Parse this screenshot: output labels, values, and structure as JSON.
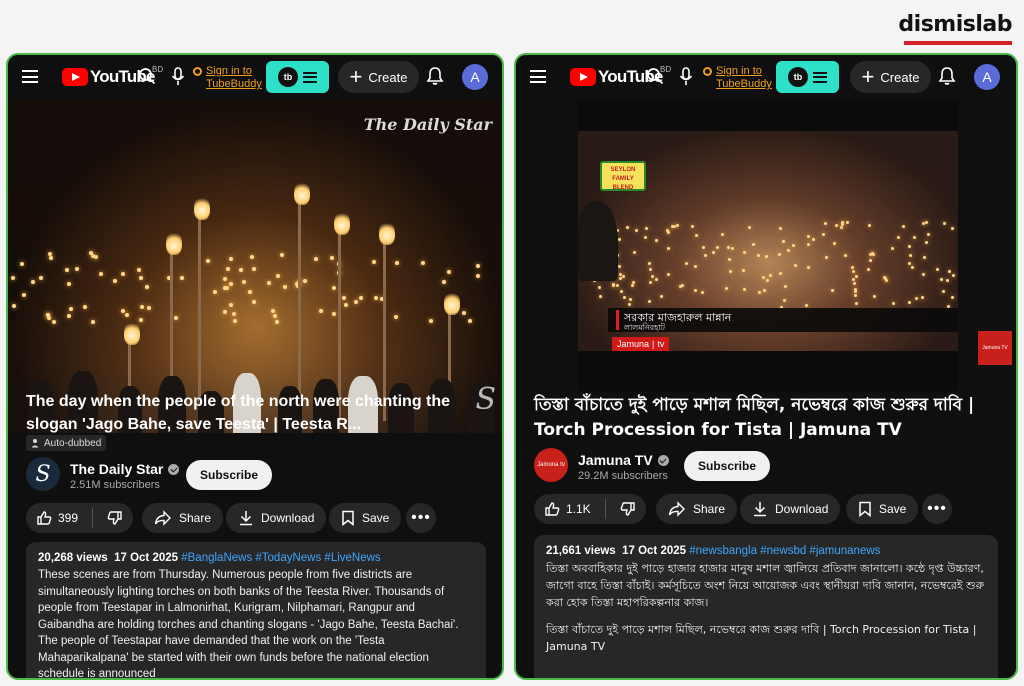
{
  "brand": {
    "name": "dismislab"
  },
  "left": {
    "header": {
      "logo_text": "YouTube",
      "region": "BD",
      "signin": "Sign in to TubeBuddy",
      "tubebuddy_logo": "tb",
      "create_label": "Create",
      "avatar_letter": "A"
    },
    "video": {
      "watermark": "The Daily Star",
      "corner_mark": "S"
    },
    "title": "The day when the people of the north were chanting the slogan 'Jago Bahe, save Teesta' | Teesta R...",
    "auto_dubbed": "Auto-dubbed",
    "channel": {
      "name": "The Daily Star",
      "subscribers": "2.51M subscribers",
      "avatar_letter": "S"
    },
    "subscribe_label": "Subscribe",
    "actions": {
      "likes": "399",
      "share": "Share",
      "download": "Download",
      "save": "Save",
      "more": "•••"
    },
    "description": {
      "views": "20,268 views",
      "date": "17 Oct 2025",
      "tags": "#BanglaNews #TodayNews #LiveNews",
      "text": "These scenes are from Thursday. Numerous people from five districts are simultaneously lighting torches on both banks of the Teesta River. Thousands of people from Teestapar in Lalmonirhat, Kurigram, Nilphamari, Rangpur and Gaibandha are holding torches and chanting slogans - 'Jago Bahe, Teesta Bachai'. The people of Teestapar have demanded that the work on the 'Testa Mahaparikalpana' be started with their own funds before the national election schedule is announced"
    }
  },
  "right": {
    "header": {
      "logo_text": "YouTube",
      "region": "BD",
      "signin": "Sign in to TubeBuddy",
      "tubebuddy_logo": "tb",
      "create_label": "Create",
      "avatar_letter": "A"
    },
    "video": {
      "sponsor": "SEYLON FAMILY BLEND",
      "lower_third_name": "সরকার মাজহারুল মান্নান",
      "lower_third_place": "লালমনিরহাট",
      "channel_tag": "Jamuna",
      "channel_tag_suffix": "tv",
      "side_thumb": "Jamuna TV"
    },
    "title": "তিস্তা বাঁচাতে দুই পাড়ে মশাল মিছিল, নভেম্বরে কাজ শুরুর দাবি | Torch Procession for Tista | Jamuna TV",
    "channel": {
      "name": "Jamuna TV",
      "subscribers": "29.2M subscribers",
      "avatar_text": "Jamuna tv"
    },
    "subscribe_label": "Subscribe",
    "actions": {
      "likes": "1.1K",
      "share": "Share",
      "download": "Download",
      "save": "Save",
      "more": "•••"
    },
    "description": {
      "views": "21,661 views",
      "date": "17 Oct 2025",
      "tags": "#newsbangla #newsbd #jamunanews",
      "text": "তিস্তা অববাহিকার দুই পাড়ে হাজার হাজার মানুষ মশাল জ্বালিয়ে প্রতিবাদ জানালো। কন্ঠে দৃপ্ত উচ্চারণ, জাগো বাহে তিস্তা বাঁচাই। কর্মসূচিতে অংশ নিয়ে আয়োজক এবং স্থানীয়রা দাবি জানান, নভেম্বরেই শুরু করা হোক তিস্তা মহাপরিকল্পনার কাজ।",
      "text2": "তিস্তা বাঁচাতে দুই পাড়ে মশাল মিছিল, নভেম্বরে কাজ শুরুর দাবি | Torch Procession for Tista | Jamuna TV"
    }
  }
}
